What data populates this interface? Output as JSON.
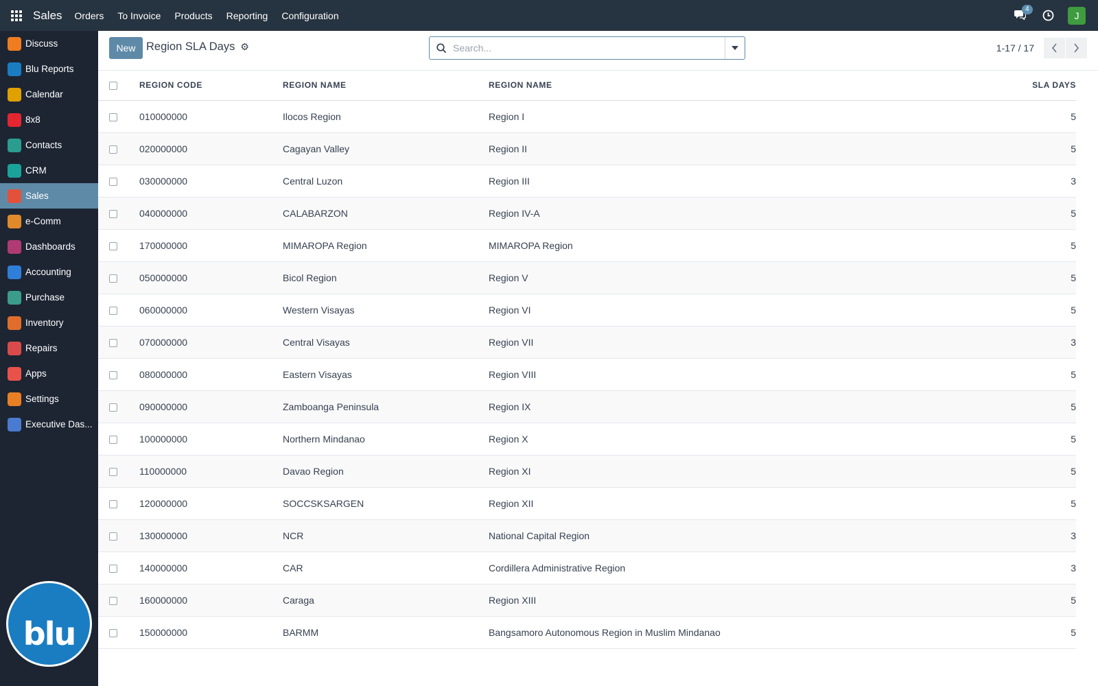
{
  "topbar": {
    "brand": "Sales",
    "menu": [
      "Orders",
      "To Invoice",
      "Products",
      "Reporting",
      "Configuration"
    ],
    "chat_count": "4",
    "avatar_letter": "J"
  },
  "sidebar": {
    "items": [
      {
        "label": "Discuss",
        "icon": "discuss-icon",
        "color": "#f07c21"
      },
      {
        "label": "Blu Reports",
        "icon": "blu-reports-icon",
        "color": "#1a7dc2"
      },
      {
        "label": "Calendar",
        "icon": "calendar-icon",
        "color": "#e0a000"
      },
      {
        "label": "8x8",
        "icon": "8x8-icon",
        "color": "#e3262f"
      },
      {
        "label": "Contacts",
        "icon": "contacts-icon",
        "color": "#2a9d8f"
      },
      {
        "label": "CRM",
        "icon": "crm-icon",
        "color": "#1aa39a"
      },
      {
        "label": "Sales",
        "icon": "sales-icon",
        "color": "#e4513b"
      },
      {
        "label": "e-Comm",
        "icon": "ecomm-icon",
        "color": "#e08a2b"
      },
      {
        "label": "Dashboards",
        "icon": "dashboards-icon",
        "color": "#b03a74"
      },
      {
        "label": "Accounting",
        "icon": "accounting-icon",
        "color": "#2f7ed8"
      },
      {
        "label": "Purchase",
        "icon": "purchase-icon",
        "color": "#3b9c8c"
      },
      {
        "label": "Inventory",
        "icon": "inventory-icon",
        "color": "#e06d2b"
      },
      {
        "label": "Repairs",
        "icon": "repairs-icon",
        "color": "#d94b4b"
      },
      {
        "label": "Apps",
        "icon": "apps-icon",
        "color": "#e9524a"
      },
      {
        "label": "Settings",
        "icon": "settings-icon",
        "color": "#e87f23"
      },
      {
        "label": "Executive Das...",
        "icon": "executive-dashboard-icon",
        "color": "#4a7bd0"
      }
    ],
    "active_index": 6,
    "logo_text": "blu"
  },
  "control_panel": {
    "new_label": "New",
    "title": "Region SLA Days",
    "search_placeholder": "Search...",
    "pager": "1-17 / 17"
  },
  "table": {
    "headers": [
      "REGION CODE",
      "REGION NAME",
      "REGION NAME",
      "SLA DAYS"
    ],
    "rows": [
      {
        "code": "010000000",
        "name": "Ilocos Region",
        "region": "Region I",
        "sla": "5"
      },
      {
        "code": "020000000",
        "name": "Cagayan Valley",
        "region": "Region II",
        "sla": "5"
      },
      {
        "code": "030000000",
        "name": "Central Luzon",
        "region": "Region III",
        "sla": "3"
      },
      {
        "code": "040000000",
        "name": "CALABARZON",
        "region": "Region IV-A",
        "sla": "5"
      },
      {
        "code": "170000000",
        "name": "MIMAROPA Region",
        "region": "MIMAROPA Region",
        "sla": "5"
      },
      {
        "code": "050000000",
        "name": "Bicol Region",
        "region": "Region V",
        "sla": "5"
      },
      {
        "code": "060000000",
        "name": "Western Visayas",
        "region": "Region VI",
        "sla": "5"
      },
      {
        "code": "070000000",
        "name": "Central Visayas",
        "region": "Region VII",
        "sla": "3"
      },
      {
        "code": "080000000",
        "name": "Eastern Visayas",
        "region": "Region VIII",
        "sla": "5"
      },
      {
        "code": "090000000",
        "name": "Zamboanga Peninsula",
        "region": "Region IX",
        "sla": "5"
      },
      {
        "code": "100000000",
        "name": "Northern Mindanao",
        "region": "Region X",
        "sla": "5"
      },
      {
        "code": "110000000",
        "name": "Davao Region",
        "region": "Region XI",
        "sla": "5"
      },
      {
        "code": "120000000",
        "name": "SOCCSKSARGEN",
        "region": "Region XII",
        "sla": "5"
      },
      {
        "code": "130000000",
        "name": "NCR",
        "region": "National Capital Region",
        "sla": "3"
      },
      {
        "code": "140000000",
        "name": "CAR",
        "region": "Cordillera Administrative Region",
        "sla": "3"
      },
      {
        "code": "160000000",
        "name": "Caraga",
        "region": "Region XIII",
        "sla": "5"
      },
      {
        "code": "150000000",
        "name": "BARMM",
        "region": "Bangsamoro Autonomous Region in Muslim Mindanao",
        "sla": "5"
      }
    ]
  },
  "colors": {
    "topbar": "#263340",
    "sidebar": "#1d2533",
    "accent": "#5e8aa8"
  }
}
